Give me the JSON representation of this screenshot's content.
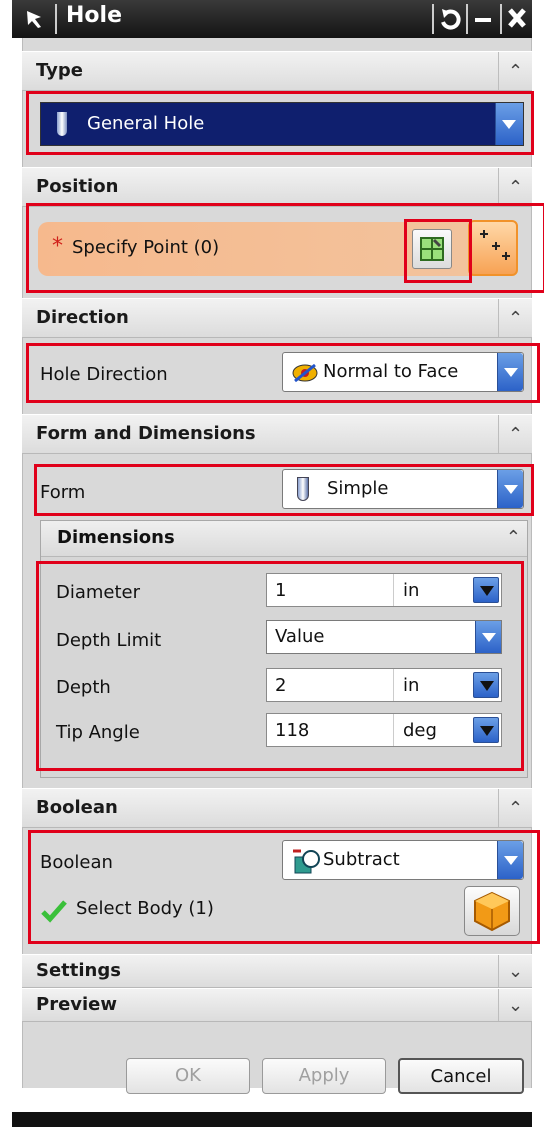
{
  "window": {
    "title": "Hole"
  },
  "type": {
    "header": "Type",
    "selected": "General Hole"
  },
  "position": {
    "header": "Position",
    "specify_point": "Specify Point (0)",
    "required_marker": "*"
  },
  "direction": {
    "header": "Direction",
    "hole_direction_label": "Hole Direction",
    "hole_direction_value": "Normal to Face"
  },
  "form_dims": {
    "header": "Form and Dimensions",
    "form_label": "Form",
    "form_value": "Simple",
    "dimensions": {
      "header": "Dimensions",
      "rows": [
        {
          "label": "Diameter",
          "value": "1",
          "unit": "in"
        },
        {
          "label": "Depth Limit",
          "value": "Value",
          "unit": ""
        },
        {
          "label": "Depth",
          "value": "2",
          "unit": "in"
        },
        {
          "label": "Tip Angle",
          "value": "118",
          "unit": "deg"
        }
      ]
    }
  },
  "boolean": {
    "header": "Boolean",
    "label": "Boolean",
    "value": "Subtract",
    "select_body": "Select Body (1)"
  },
  "settings": {
    "header": "Settings"
  },
  "preview": {
    "header": "Preview"
  },
  "buttons": {
    "ok": "OK",
    "apply": "Apply",
    "cancel": "Cancel"
  },
  "colors": {
    "highlight": "#e0001a",
    "selection_blue": "#0f1f6e",
    "point_orange": "#f0a877"
  }
}
